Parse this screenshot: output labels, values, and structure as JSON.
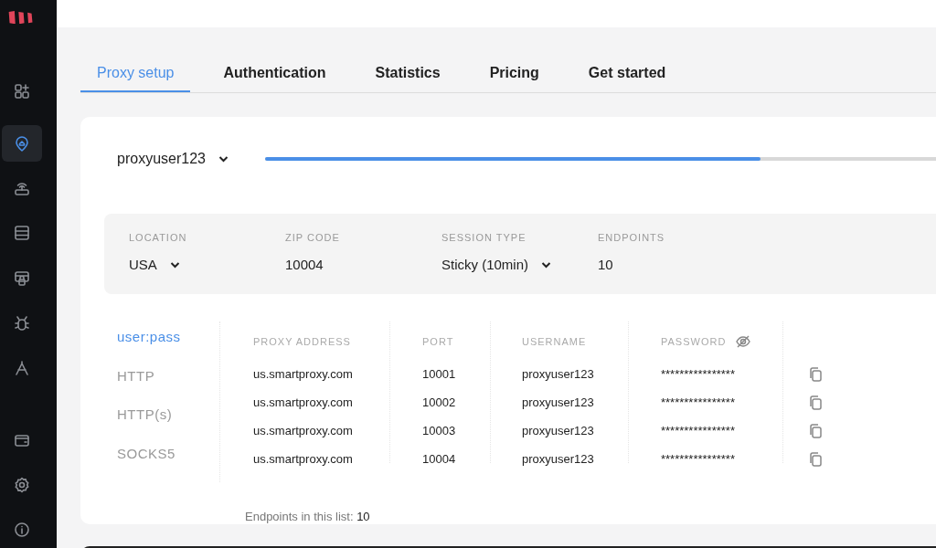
{
  "sidebar": {
    "items": [
      {
        "selected": false
      },
      {
        "selected": true
      },
      {
        "selected": false
      },
      {
        "selected": false
      },
      {
        "selected": false
      },
      {
        "selected": false
      },
      {
        "selected": false
      },
      {
        "selected": false
      },
      {
        "selected": false
      },
      {
        "selected": false
      }
    ]
  },
  "tabs": [
    {
      "label": "Proxy setup",
      "selected": true
    },
    {
      "label": "Authentication",
      "selected": false
    },
    {
      "label": "Statistics",
      "selected": false
    },
    {
      "label": "Pricing",
      "selected": false
    },
    {
      "label": "Get started",
      "selected": false
    }
  ],
  "user_selector": {
    "value": "proxyuser123"
  },
  "progress": {
    "level": 0.71
  },
  "filters": [
    {
      "label": "LOCATION",
      "value": "USA",
      "kind": "dropdown"
    },
    {
      "label": "ZIP CODE",
      "value": "10004",
      "kind": "text"
    },
    {
      "label": "SESSION TYPE",
      "value": "Sticky (10min)",
      "kind": "dropdown"
    },
    {
      "label": "ENDPOINTS",
      "value": "10",
      "kind": "text"
    }
  ],
  "protocols": [
    {
      "label": "user:pass",
      "selected": true
    },
    {
      "label": "HTTP",
      "selected": false
    },
    {
      "label": "HTTP(s)",
      "selected": false
    },
    {
      "label": "SOCKS5",
      "selected": false
    }
  ],
  "table": {
    "columns": [
      "PROXY ADDRESS",
      "PORT",
      "USERNAME",
      "PASSWORD"
    ],
    "rows": [
      [
        "us.smartproxy.com",
        "10001",
        "proxyuser123",
        "****************"
      ],
      [
        "us.smartproxy.com",
        "10002",
        "proxyuser123",
        "****************"
      ],
      [
        "us.smartproxy.com",
        "10003",
        "proxyuser123",
        "****************"
      ],
      [
        "us.smartproxy.com",
        "10004",
        "proxyuser123",
        "****************"
      ]
    ]
  },
  "footer": {
    "text": "Endpoints in this list: **10**"
  }
}
